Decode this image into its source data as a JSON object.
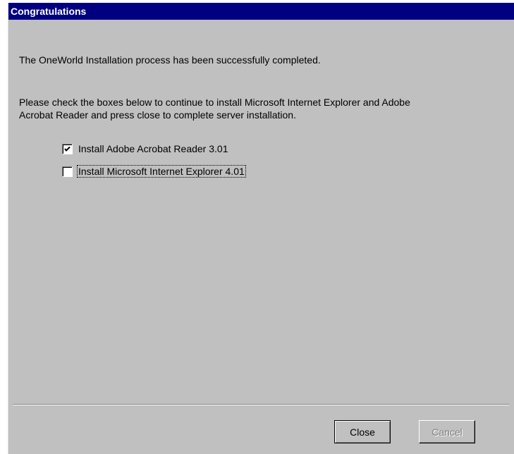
{
  "window": {
    "title": "Congratulations"
  },
  "content": {
    "message_completed": "The OneWorld Installation process has been successfully completed.",
    "message_instructions_line1": "Please check the boxes below to continue to install Microsoft Internet Explorer and Adobe",
    "message_instructions_line2": "Acrobat Reader and press close to complete server installation."
  },
  "options": [
    {
      "label": "Install Adobe Acrobat Reader 3.01",
      "checked": true
    },
    {
      "label": "Install Microsoft Internet Explorer 4.01",
      "checked": false,
      "focused": true
    }
  ],
  "buttons": {
    "close_label": "Close",
    "cancel_label": "Cancel",
    "cancel_enabled": false
  },
  "colors": {
    "titlebar": "#000080",
    "dialog_bg": "#c0c0c0",
    "disabled_text": "#808080"
  }
}
